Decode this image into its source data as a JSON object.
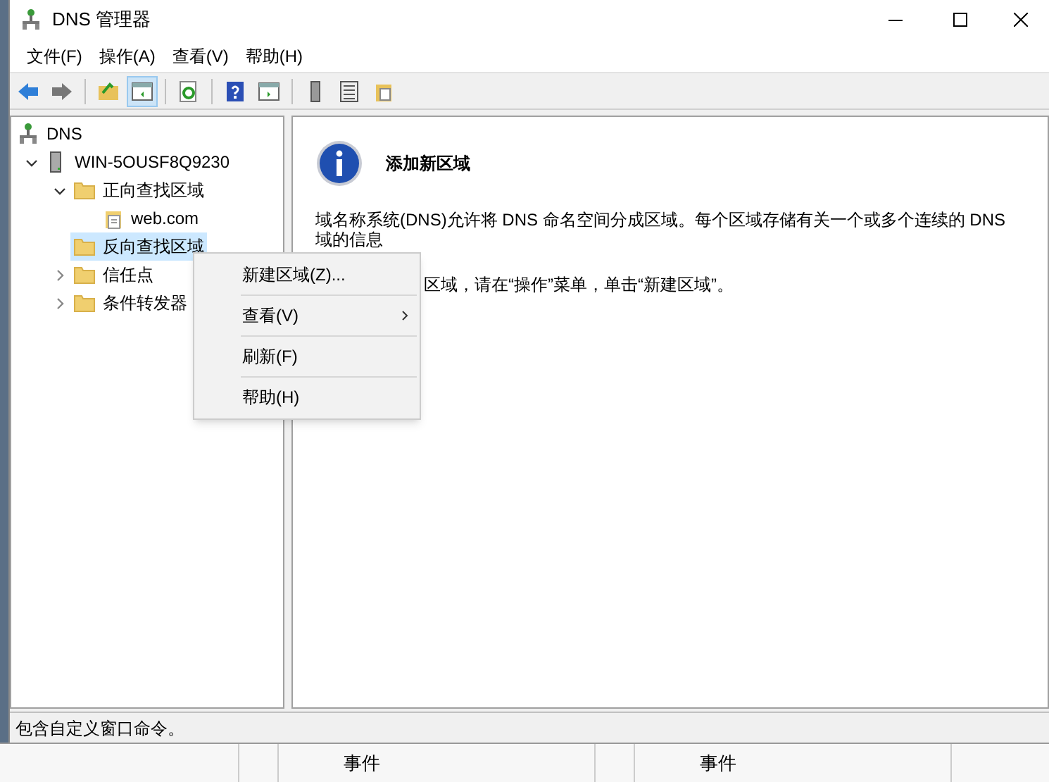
{
  "window": {
    "title": "DNS 管理器"
  },
  "menu_bar": [
    "文件(F)",
    "操作(A)",
    "查看(V)",
    "帮助(H)"
  ],
  "toolbar": [
    {
      "kind": "back",
      "pressed": false
    },
    {
      "kind": "forward",
      "pressed": false
    },
    {
      "kind": "sep"
    },
    {
      "kind": "up",
      "pressed": false
    },
    {
      "kind": "tree",
      "pressed": true
    },
    {
      "kind": "sep"
    },
    {
      "kind": "refresh",
      "pressed": false
    },
    {
      "kind": "sep"
    },
    {
      "kind": "help",
      "pressed": false
    },
    {
      "kind": "pane",
      "pressed": false
    },
    {
      "kind": "sep"
    },
    {
      "kind": "server",
      "pressed": false
    },
    {
      "kind": "list",
      "pressed": false
    },
    {
      "kind": "props",
      "pressed": false
    }
  ],
  "tree": [
    {
      "label": "DNS",
      "kind": "dns",
      "selected": false,
      "children": [
        {
          "label": "WIN-5OUSF8Q9230",
          "kind": "server",
          "expanded": true,
          "selected": false,
          "children": [
            {
              "label": "正向查找区域",
              "kind": "folder",
              "expanded": true,
              "selected": false,
              "children": [
                {
                  "label": "web.com",
                  "kind": "zone",
                  "selected": false
                }
              ]
            },
            {
              "label": "反向查找区域",
              "kind": "folder",
              "selected": true
            },
            {
              "label": "信任点",
              "kind": "folder",
              "expanded": false,
              "selected": false
            },
            {
              "label": "条件转发器",
              "kind": "folder",
              "expanded": false,
              "selected": false
            }
          ]
        }
      ]
    }
  ],
  "details": {
    "heading": "添加新区域",
    "paragraphs": [
      "域名称系统(DNS)允许将 DNS 命名空间分成区域。每个区域存储有关一个或多个连续的 DNS 域的信息",
      "区域，请在“操作”菜单，单击“新建区域”。"
    ]
  },
  "context_menu": [
    {
      "label": "新建区域(Z)...",
      "submenu": false
    },
    {
      "label": "查看(V)",
      "submenu": true
    },
    {
      "label": "刷新(F)",
      "submenu": false
    },
    {
      "label": "帮助(H)",
      "submenu": false
    }
  ],
  "status_bar": "包含自定义窗口命令。",
  "background_columns": [
    "事件",
    "事件"
  ]
}
